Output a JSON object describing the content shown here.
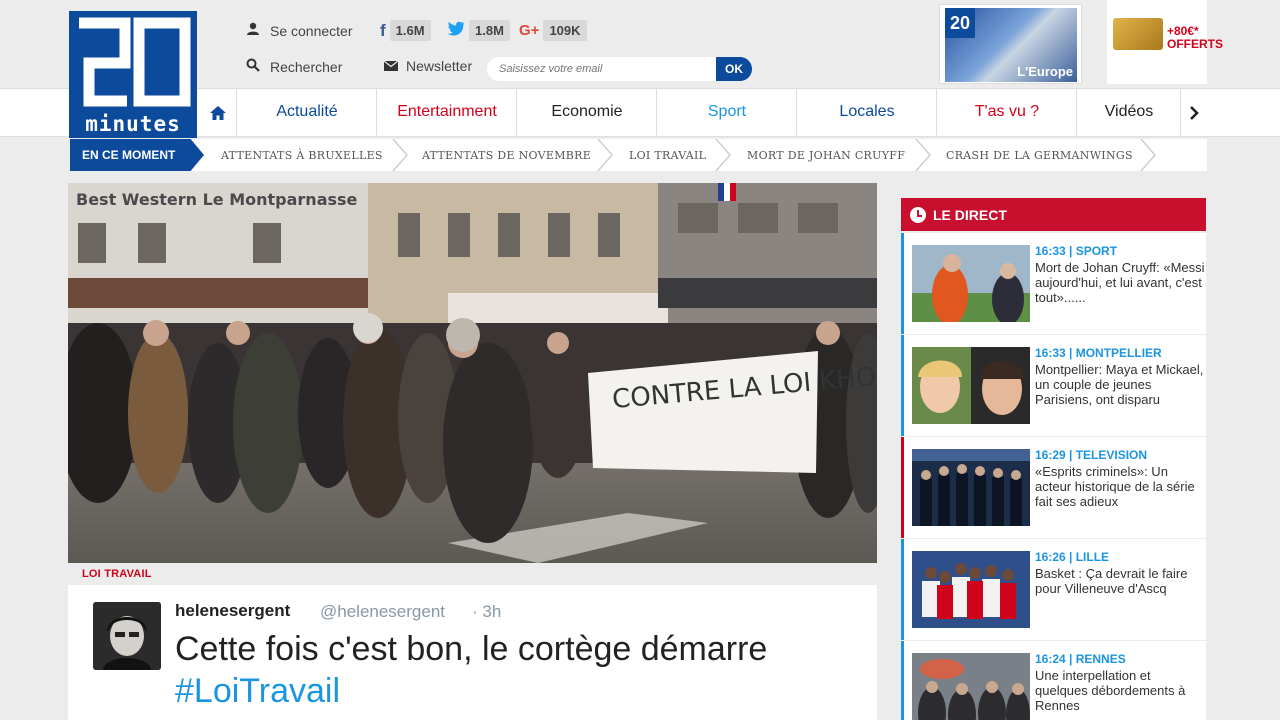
{
  "header": {
    "logo_sub": "minutes",
    "login_label": "Se connecter",
    "search_label": "Rechercher",
    "newsletter_label": "Newsletter",
    "newsletter_placeholder": "Saisissez votre email",
    "ok_label": "OK",
    "social": {
      "facebook": "1.6M",
      "twitter": "1.8M",
      "google": "109K"
    },
    "ad_newspaper_title": "L'Europe",
    "ad_newspaper_logo": "20",
    "ad_promo": "+80€* OFFERTS"
  },
  "nav": {
    "items": [
      {
        "label": "Actualité",
        "color": "#0c4a9c"
      },
      {
        "label": "Entertainment",
        "color": "#d0021b"
      },
      {
        "label": "Economie",
        "color": "#222222"
      },
      {
        "label": "Sport",
        "color": "#1b95e0"
      },
      {
        "label": "Locales",
        "color": "#0c4a9c"
      },
      {
        "label": "T'as vu ?",
        "color": "#d0021b"
      },
      {
        "label": "Vidéos",
        "color": "#222222"
      }
    ]
  },
  "subnav": {
    "badge": "EN CE MOMENT",
    "items": [
      "ATTENTATS À BRUXELLES",
      "ATTENTATS DE NOVEMBRE",
      "LOI TRAVAIL",
      "MORT DE JOHAN CRUYFF",
      "CRASH DE LA GERMANWINGS"
    ]
  },
  "article": {
    "kicker": "LOI TRAVAIL",
    "photo_banner": "CONTRE LA LOI KHOMRI",
    "photo_sign": "Best Western Le Montparnasse",
    "tweet": {
      "name": "helenesergent",
      "handle": "@helenesergent",
      "time": "· 3h",
      "text": "Cette fois c'est bon, le cortège démarre",
      "hashtag": "#LoiTravail"
    }
  },
  "direct": {
    "title": "LE DIRECT",
    "items": [
      {
        "meta": "16:33 | SPORT",
        "title": "Mort de Johan Cruyff: «Messi aujourd'hui, et lui avant, c'est tout»......"
      },
      {
        "meta": "16:33 | MONTPELLIER",
        "title": "Montpellier: Maya et Mickael, un couple de jeunes Parisiens, ont disparu"
      },
      {
        "meta": "16:29 | TELEVISION",
        "title": "«Esprits criminels»: Un acteur historique de la série fait ses adieux"
      },
      {
        "meta": "16:26 | LILLE",
        "title": "Basket : Ça devrait le faire pour Villeneuve d'Ascq"
      },
      {
        "meta": "16:24 | RENNES",
        "title": "Une interpellation et quelques débordements à Rennes"
      }
    ]
  }
}
